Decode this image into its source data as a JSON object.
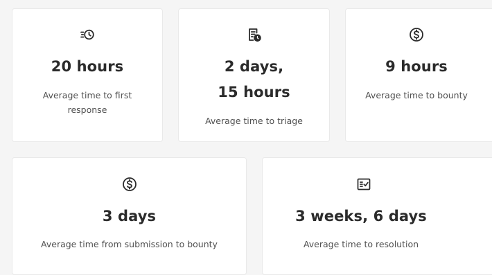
{
  "stats": [
    {
      "value": "20 hours",
      "label": "Average time to first response",
      "icon": "clock-fast-icon"
    },
    {
      "value": "2 days, 15 hours",
      "label": "Average time to triage",
      "icon": "document-clock-icon"
    },
    {
      "value": "9 hours",
      "label": "Average time to bounty",
      "icon": "dollar-circle-icon"
    },
    {
      "value": "3 days",
      "label": "Average time from submission to bounty",
      "icon": "dollar-circle-icon"
    },
    {
      "value": "3 weeks, 6 days",
      "label": "Average time to resolution",
      "icon": "checklist-icon"
    }
  ]
}
